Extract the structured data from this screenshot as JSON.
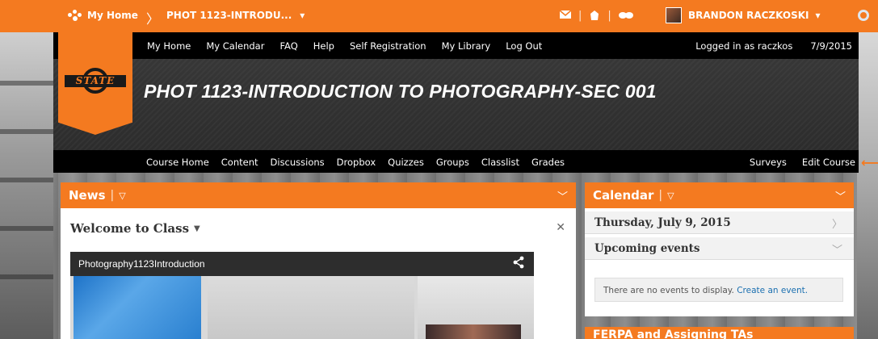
{
  "topbar": {
    "home_label": "My Home",
    "course_crumb": "PHOT 1123-INTRODU...",
    "course_crumb_chevron": "▾",
    "user_name": "BRANDON RACZKOSKI",
    "user_chevron": "▾",
    "icons": [
      "mail-icon",
      "alerts-icon",
      "chat-icon",
      "gear-icon"
    ]
  },
  "navbar": {
    "links": [
      "My Home",
      "My Calendar",
      "FAQ",
      "Help",
      "Self Registration",
      "My Library",
      "Log Out"
    ],
    "logged_in": "Logged in as raczkos",
    "date": "7/9/2015"
  },
  "logo": {
    "word": "STATE"
  },
  "course_title": "PHOT 1123-INTRODUCTION TO PHOTOGRAPHY-SEC 001",
  "course_nav": {
    "left": [
      "Course Home",
      "Content",
      "Discussions",
      "Dropbox",
      "Quizzes",
      "Groups",
      "Classlist",
      "Grades"
    ],
    "right": [
      "Surveys",
      "Edit Course"
    ]
  },
  "news": {
    "title": "News",
    "item_title": "Welcome to Class",
    "video_title": "Photography1123Introduction"
  },
  "calendar": {
    "title": "Calendar",
    "date_row": "Thursday, July 9, 2015",
    "upcoming_row": "Upcoming events",
    "no_events": "There are no events to display.",
    "create_link": "Create an event."
  },
  "ferpa": {
    "title": "FERPA and Assigning TAs"
  },
  "colors": {
    "brand_orange": "#f47a20",
    "nav_black": "#000000",
    "link_blue": "#1a6fb0"
  }
}
